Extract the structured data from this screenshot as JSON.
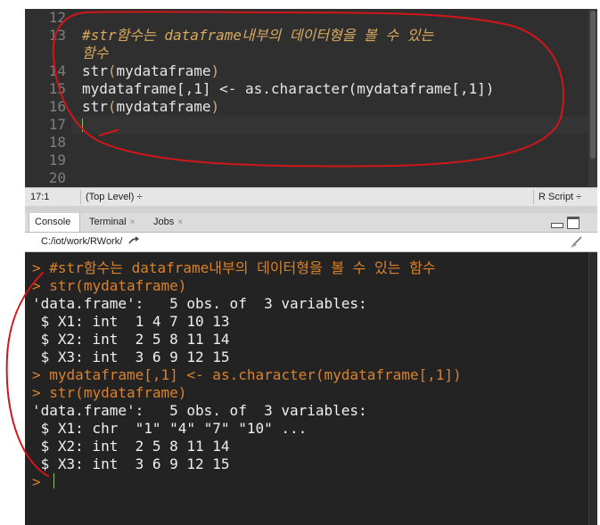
{
  "editor": {
    "lines": [
      {
        "num": "12"
      },
      {
        "num": "13",
        "comment": "#str함수는 dataframe내부의 데이터형을 볼 수 있는"
      },
      {
        "num": "",
        "comment": "함수"
      },
      {
        "num": "14",
        "fn": "str",
        "arg": "mydataframe"
      },
      {
        "num": "15",
        "code": "mydataframe[,1] <- as.character(mydataframe[,1])"
      },
      {
        "num": "16",
        "fn": "str",
        "arg": "mydataframe"
      },
      {
        "num": "17"
      },
      {
        "num": "18"
      },
      {
        "num": "19"
      },
      {
        "num": "20"
      }
    ],
    "status": {
      "position": "17:1",
      "scope": "(Top Level) ÷",
      "file_type": "R Script ÷"
    }
  },
  "console_pane": {
    "tabs": [
      {
        "label": "Console",
        "closable": false,
        "active": true
      },
      {
        "label": "Terminal",
        "closable": true,
        "active": false
      },
      {
        "label": "Jobs",
        "closable": true,
        "active": false
      }
    ],
    "close_glyph": "×",
    "working_dir": "C:/iot/work/RWork/",
    "output": [
      {
        "prompt": ">",
        "text": "#str함수는 dataframe내부의 데이터형을 볼 수 있는 함수",
        "kind": "command"
      },
      {
        "prompt": ">",
        "text": "str(mydataframe)",
        "kind": "command"
      },
      {
        "prompt": "",
        "text": "'data.frame':\t5 obs. of  3 variables:",
        "kind": "output"
      },
      {
        "prompt": "",
        "text": " $ X1: int  1 4 7 10 13",
        "kind": "output"
      },
      {
        "prompt": "",
        "text": " $ X2: int  2 5 8 11 14",
        "kind": "output"
      },
      {
        "prompt": "",
        "text": " $ X3: int  3 6 9 12 15",
        "kind": "output"
      },
      {
        "prompt": ">",
        "text": "mydataframe[,1] <- as.character(mydataframe[,1])",
        "kind": "command"
      },
      {
        "prompt": ">",
        "text": "str(mydataframe)",
        "kind": "command"
      },
      {
        "prompt": "",
        "text": "'data.frame':\t5 obs. of  3 variables:",
        "kind": "output"
      },
      {
        "prompt": "",
        "text": " $ X1: chr  \"1\" \"4\" \"7\" \"10\" ...",
        "kind": "output"
      },
      {
        "prompt": "",
        "text": " $ X2: int  2 5 8 11 14",
        "kind": "output"
      },
      {
        "prompt": "",
        "text": " $ X3: int  3 6 9 12 15",
        "kind": "output"
      },
      {
        "prompt": ">",
        "text": "",
        "kind": "input"
      }
    ]
  },
  "colors": {
    "prompt": "#d9822b",
    "comment": "#d8a95c",
    "annotation": "#d0161a",
    "background": "#2b2b2b"
  },
  "icons": {
    "path_arrow": "arrow-right-icon",
    "clear_console": "broom-icon",
    "minimize": "minimize-icon",
    "maximize": "maximize-icon"
  }
}
